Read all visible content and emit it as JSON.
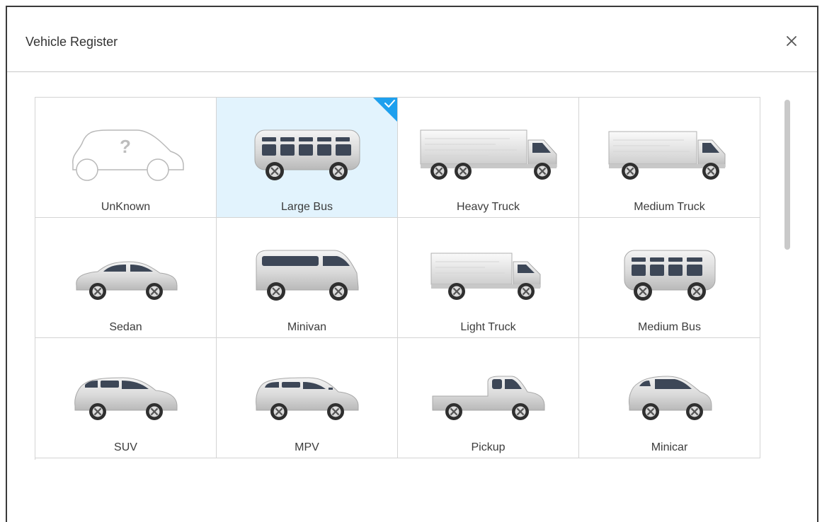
{
  "dialog": {
    "title": "Vehicle Register",
    "close_icon": "close-icon"
  },
  "colors": {
    "selected_background": "#e2f3fd",
    "check_badge": "#1ea0ee",
    "window_glass": "#3d4757",
    "body_gradient_light": "#f4f4f4",
    "body_gradient_dark": "#b9b9b9"
  },
  "vehicles": [
    {
      "label": "UnKnown",
      "icon": "unknown-vehicle-icon",
      "selected": false
    },
    {
      "label": "Large Bus",
      "icon": "large-bus-icon",
      "selected": true
    },
    {
      "label": "Heavy Truck",
      "icon": "heavy-truck-icon",
      "selected": false
    },
    {
      "label": "Medium Truck",
      "icon": "medium-truck-icon",
      "selected": false
    },
    {
      "label": "Sedan",
      "icon": "sedan-icon",
      "selected": false
    },
    {
      "label": "Minivan",
      "icon": "minivan-icon",
      "selected": false
    },
    {
      "label": "Light Truck",
      "icon": "light-truck-icon",
      "selected": false
    },
    {
      "label": "Medium Bus",
      "icon": "medium-bus-icon",
      "selected": false
    },
    {
      "label": "SUV",
      "icon": "suv-icon",
      "selected": false
    },
    {
      "label": "MPV",
      "icon": "mpv-icon",
      "selected": false
    },
    {
      "label": "Pickup",
      "icon": "pickup-icon",
      "selected": false
    },
    {
      "label": "Minicar",
      "icon": "minicar-icon",
      "selected": false
    }
  ]
}
